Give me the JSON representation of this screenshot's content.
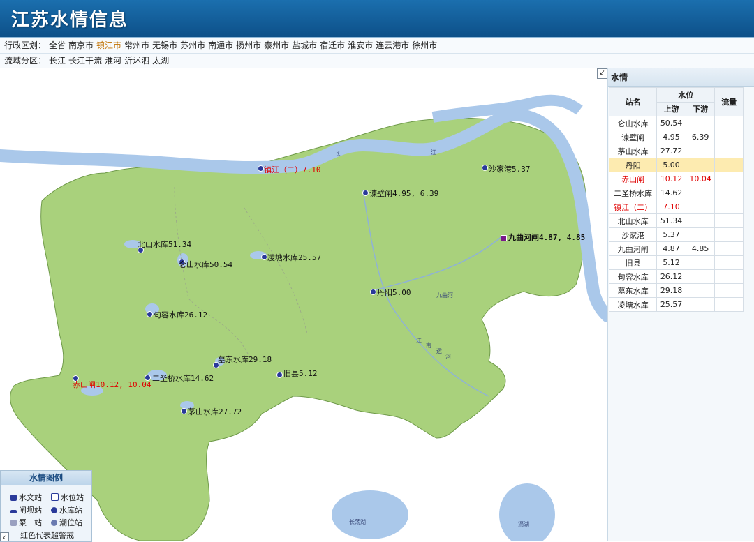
{
  "header": {
    "title": "江苏水情信息"
  },
  "nav_admin": {
    "label": "行政区划：",
    "items": [
      "全省",
      "南京市",
      "镇江市",
      "常州市",
      "无锡市",
      "苏州市",
      "南通市",
      "扬州市",
      "泰州市",
      "盐城市",
      "宿迁市",
      "淮安市",
      "连云港市",
      "徐州市"
    ],
    "active": "镇江市"
  },
  "nav_basin": {
    "label": "流域分区：",
    "items": [
      "长江",
      "长江干流",
      "淮河",
      "沂沭泗",
      "太湖"
    ]
  },
  "map": {
    "stations": [
      {
        "label": "镇江（二）7.10",
        "alert": true
      },
      {
        "label": "沙家港5.37"
      },
      {
        "label": "谏壁闸4.95, 6.39"
      },
      {
        "label": "九曲河闸4.87, 4.85",
        "bold": true
      },
      {
        "label": "北山水库51.34"
      },
      {
        "label": "仑山水库50.54"
      },
      {
        "label": "凌塘水库25.57"
      },
      {
        "label": "丹阳5.00"
      },
      {
        "label": "句容水库26.12"
      },
      {
        "label": "墓东水库29.18"
      },
      {
        "label": "旧县5.12"
      },
      {
        "label": "赤山闸10.12, 10.04",
        "alert": true
      },
      {
        "label": "二圣桥水库14.62"
      },
      {
        "label": "茅山水库27.72"
      }
    ],
    "map_text": {
      "chang": "长",
      "jiang": "江",
      "jiuquhe": "九曲河",
      "jiangnan1": "江",
      "jiangnan2": "南",
      "jiangnan3": "运",
      "jiangnan4": "河",
      "lake1": "长荡湖",
      "lake2": "滆湖"
    }
  },
  "panel": {
    "title": "水情",
    "headers": {
      "station": "站名",
      "level": "水位",
      "upstream": "上游",
      "downstream": "下游",
      "flow": "流量"
    },
    "rows": [
      {
        "name": "仑山水库",
        "up": "50.54",
        "down": "",
        "flow": ""
      },
      {
        "name": "谏壁闸",
        "up": "4.95",
        "down": "6.39",
        "flow": ""
      },
      {
        "name": "茅山水库",
        "up": "27.72",
        "down": "",
        "flow": ""
      },
      {
        "name": "丹阳",
        "up": "5.00",
        "down": "",
        "flow": "",
        "highlight": true
      },
      {
        "name": "赤山闸",
        "up": "10.12",
        "down": "10.04",
        "flow": "",
        "alert": true
      },
      {
        "name": "二圣桥水库",
        "up": "14.62",
        "down": "",
        "flow": ""
      },
      {
        "name": "镇江（二）",
        "up": "7.10",
        "down": "",
        "flow": "",
        "alert": true
      },
      {
        "name": "北山水库",
        "up": "51.34",
        "down": "",
        "flow": ""
      },
      {
        "name": "沙家港",
        "up": "5.37",
        "down": "",
        "flow": ""
      },
      {
        "name": "九曲河闸",
        "up": "4.87",
        "down": "4.85",
        "flow": ""
      },
      {
        "name": "旧县",
        "up": "5.12",
        "down": "",
        "flow": ""
      },
      {
        "name": "句容水库",
        "up": "26.12",
        "down": "",
        "flow": ""
      },
      {
        "name": "墓东水库",
        "up": "29.18",
        "down": "",
        "flow": ""
      },
      {
        "name": "凌塘水库",
        "up": "25.57",
        "down": "",
        "flow": ""
      }
    ]
  },
  "legend": {
    "title": "水情图例",
    "items": [
      "水文站",
      "水位站",
      "闸坝站",
      "水库站",
      "泵　站",
      "潮位站"
    ],
    "note": "红色代表超警戒"
  },
  "colors": {
    "land": "#a9d17c",
    "water": "#aac8ea",
    "alert": "#e00000",
    "header": "#0d5089"
  }
}
